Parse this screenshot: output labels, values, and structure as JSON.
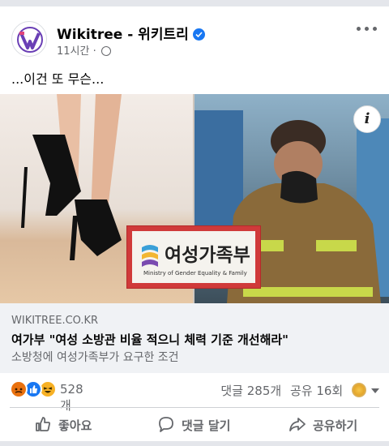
{
  "post": {
    "page_name": "Wikitree - 위키트리",
    "time": "11시간",
    "meta_separator": "·",
    "text": "...이건 또 무슨..."
  },
  "media": {
    "badge_title": "여성가족부",
    "badge_subtitle": "Ministry of Gender Equality & Family",
    "info_label": "i"
  },
  "link": {
    "domain": "WIKITREE.CO.KR",
    "title": "여가부 \"여성 소방관 비율 적으니 체력 기준 개선해라\"",
    "description": "소방청에 여성가족부가 요구한 조건"
  },
  "stats": {
    "reaction_count": "528개",
    "comments": "댓글 285개",
    "shares": "공유 16회",
    "reactions": [
      "angry-icon",
      "like-icon",
      "haha-icon"
    ]
  },
  "actions": {
    "like": "좋아요",
    "comment": "댓글 달기",
    "share": "공유하기"
  },
  "colors": {
    "facebook_blue": "#1877f2",
    "secondary_text": "#65676b",
    "link_box_bg": "#f0f2f5"
  }
}
